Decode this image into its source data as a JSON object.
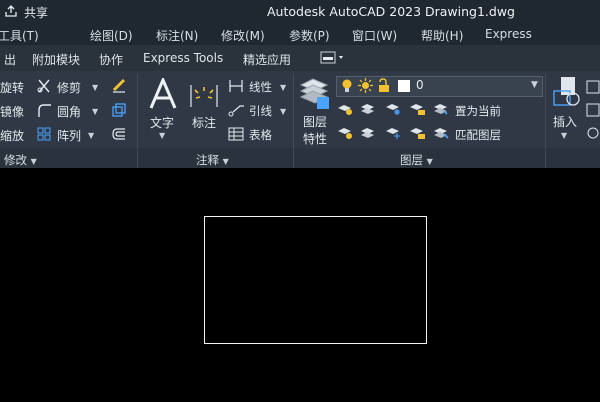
{
  "titlebar": {
    "share_label": "共享",
    "app_title": "Autodesk AutoCAD 2023",
    "doc_title": "Drawing1.dwg"
  },
  "menu": [
    "工具(T)",
    "绘图(D)",
    "标注(N)",
    "修改(M)",
    "参数(P)",
    "窗口(W)",
    "帮助(H)",
    "Express"
  ],
  "tabs": [
    "出",
    "附加模块",
    "协作",
    "Express Tools",
    "精选应用"
  ],
  "modify_panel": {
    "title": "修改",
    "items": [
      "旋转",
      "修剪",
      "镜像",
      "圆角",
      "缩放",
      "阵列"
    ]
  },
  "annotation_panel": {
    "title": "注释",
    "text_label": "文字",
    "dimension_label": "标注",
    "linear_label": "线性",
    "leader_label": "引线",
    "table_label": "表格"
  },
  "layers_panel": {
    "title": "图层",
    "properties_label_line1": "图层",
    "properties_label_line2": "特性",
    "current_layer": "0",
    "set_current_label": "置为当前",
    "match_layer_label": "匹配图层"
  },
  "insert_panel": {
    "insert_label": "插入"
  },
  "colors": {
    "titlebar_bg": "#1f2731",
    "ribbon_bg": "#2f3844",
    "canvas_bg": "#000000",
    "accent_yellow": "#f2c230",
    "accent_blue": "#4aa3ff"
  }
}
